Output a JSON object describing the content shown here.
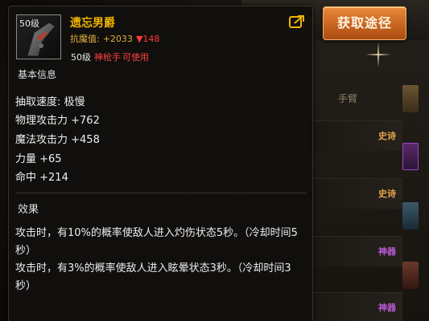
{
  "item": {
    "level_badge": "50级",
    "name": "遗忘男爵",
    "resist_label": "抗魔值:",
    "resist_plus": "+2033",
    "resist_down": "▼148",
    "req_level": "50级",
    "req_class": "神枪手",
    "req_usable": "可使用"
  },
  "basic": {
    "title": "基本信息",
    "stats": [
      "抽取速度: 极慢",
      "物理攻击力 +762",
      "魔法攻击力 +458",
      "力量 +65",
      "命中 +214"
    ]
  },
  "effect": {
    "title": "效果",
    "line1": "攻击时，有10%的概率使敌人进入灼伤状态5秒。（冷却时间5秒）",
    "line2": "攻击时，有3%的概率使敌人进入眩晕状态3秒。（冷却时间3秒）"
  },
  "obtain_button": {
    "label": "获取途径"
  },
  "background_panel": {
    "header": "手臂",
    "tags": [
      "史诗",
      "史诗",
      "神器",
      "神器"
    ]
  },
  "colors": {
    "item_name": "#f0b400",
    "class_req": "#ff4040",
    "epic": "#e5a24a",
    "rare": "#b85ad6",
    "button": "#d06a22"
  },
  "icons": {
    "share": "share-icon",
    "weapon": "weapon-icon",
    "sparkle": "sparkle-icon"
  }
}
